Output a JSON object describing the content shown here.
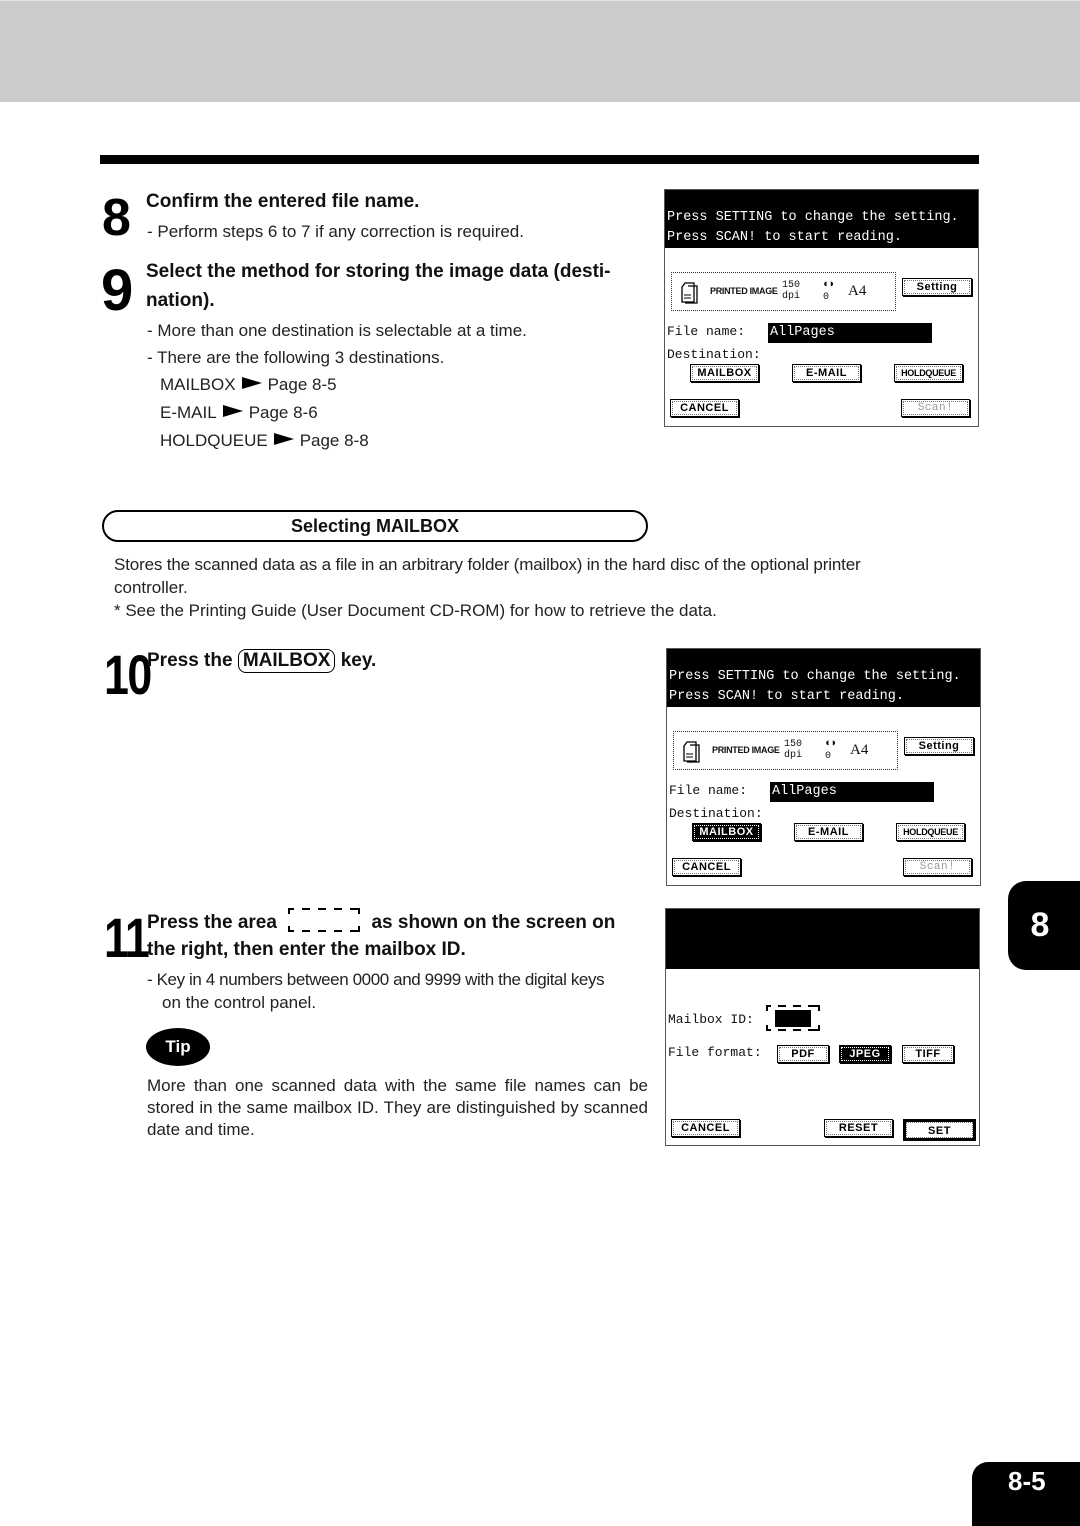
{
  "steps": {
    "s8": {
      "number": "8",
      "title": "Confirm the entered file name.",
      "bullets": [
        "-  Perform steps 6 to 7 if any correction is required."
      ]
    },
    "s9": {
      "number": "9",
      "title_line1": "Select the method for storing the image data (desti-",
      "title_line2": "nation).",
      "bullets": [
        "-  More than one destination is selectable at a time.",
        "-  There are the following 3 destinations."
      ],
      "destinations": [
        {
          "name": "MAILBOX",
          "page": "Page 8-5"
        },
        {
          "name": "E-MAIL",
          "page": "Page 8-6"
        },
        {
          "name": "HOLDQUEUE",
          "page": "Page 8-8"
        }
      ]
    },
    "s10": {
      "number": "10",
      "prefix": "Press the",
      "key": "MAILBOX",
      "suffix": "key."
    },
    "s11": {
      "number": "11",
      "prefix": "Press the area",
      "suffix": "as shown on the screen on",
      "line2": "the right, then enter the mailbox ID.",
      "bullet_line1": "-  Key in 4 numbers between 0000 and 9999 with the digital keys",
      "bullet_line2": "on the control panel."
    }
  },
  "section": {
    "title": "Selecting MAILBOX",
    "desc_line1": "Stores the scanned data as a file in an arbitrary folder (mailbox) in the hard disc of the optional printer",
    "desc_line2": "controller.",
    "note": "* See the Printing Guide (User Document CD-ROM) for how to retrieve the data."
  },
  "tip": {
    "label": "Tip",
    "text": "More than one scanned data with the same file names can be stored in the same mailbox ID.  They are distinguished by scanned date and time."
  },
  "screens": {
    "scan_screen": {
      "header": "Press SETTING to change the setting.\nPress SCAN! to start reading.",
      "mode": "PRINTED IMAGE",
      "resolution": "150",
      "resolution_unit": "dpi",
      "exposure_icon": "contrast-icon",
      "exposure": "0",
      "paper_size": "A4",
      "setting_label": "Setting",
      "file_name_label": "File name:",
      "file_name_value": "AllPages",
      "destination_label": "Destination:",
      "dest_buttons": [
        "MAILBOX",
        "E-MAIL",
        "HOLDQUEUE"
      ],
      "cancel_label": "CANCEL",
      "scan_label": "Scan!"
    },
    "mailbox_screen": {
      "mailbox_id_label": "Mailbox ID:",
      "file_format_label": "File format:",
      "formats": [
        "PDF",
        "JPEG",
        "TIFF"
      ],
      "selected_format": "JPEG",
      "cancel_label": "CANCEL",
      "reset_label": "RESET",
      "set_label": "SET"
    }
  },
  "chapter_tab": "8",
  "page_number": "8-5"
}
